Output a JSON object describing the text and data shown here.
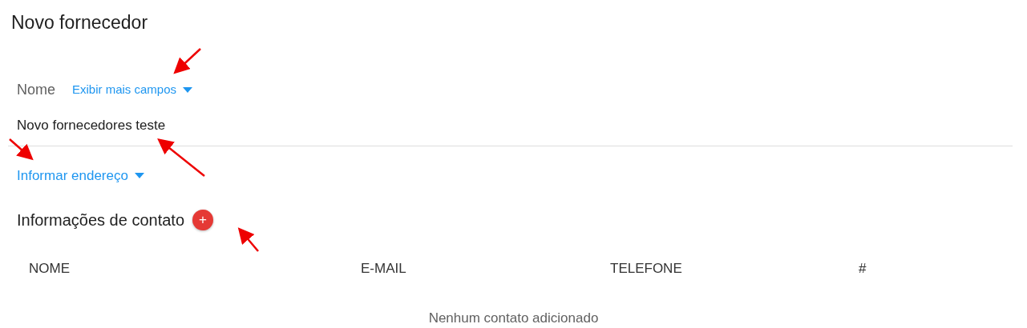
{
  "title": "Novo fornecedor",
  "name_field": {
    "label": "Nome",
    "toggle": "Exibir mais campos",
    "value": "Novo fornecedores teste"
  },
  "address_toggle": "Informar endereço",
  "contacts": {
    "title": "Informações de contato",
    "add_button": "+",
    "columns": [
      "NOME",
      "E-MAIL",
      "TELEFONE",
      "#"
    ],
    "empty_message": "Nenhum contato adicionado"
  }
}
